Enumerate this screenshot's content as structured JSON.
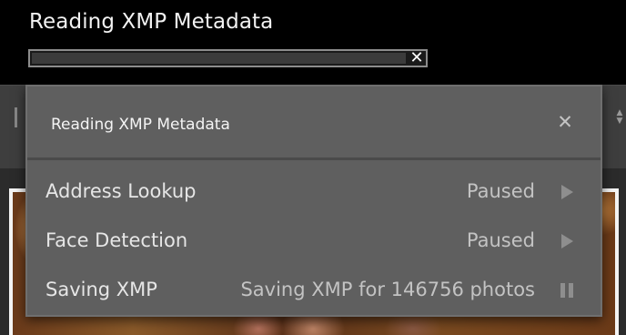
{
  "header": {
    "title": "Reading XMP Metadata",
    "progress": 0.0,
    "cancel_icon": "close-icon"
  },
  "dialog": {
    "title": "Reading XMP Metadata",
    "close_icon": "close-icon",
    "tasks": [
      {
        "name": "Address Lookup",
        "status": "Paused",
        "action_icon": "play-icon"
      },
      {
        "name": "Face Detection",
        "status": "Paused",
        "action_icon": "play-icon"
      },
      {
        "name": "Saving XMP",
        "status": "Saving XMP for 146756 photos",
        "action_icon": "pause-icon"
      }
    ]
  },
  "colors": {
    "background": "#000000",
    "dialog_bg": "#5f5f5f",
    "text": "#e6e6e6",
    "status_text": "#c3c3c3",
    "icon": "#8e8e8e"
  }
}
